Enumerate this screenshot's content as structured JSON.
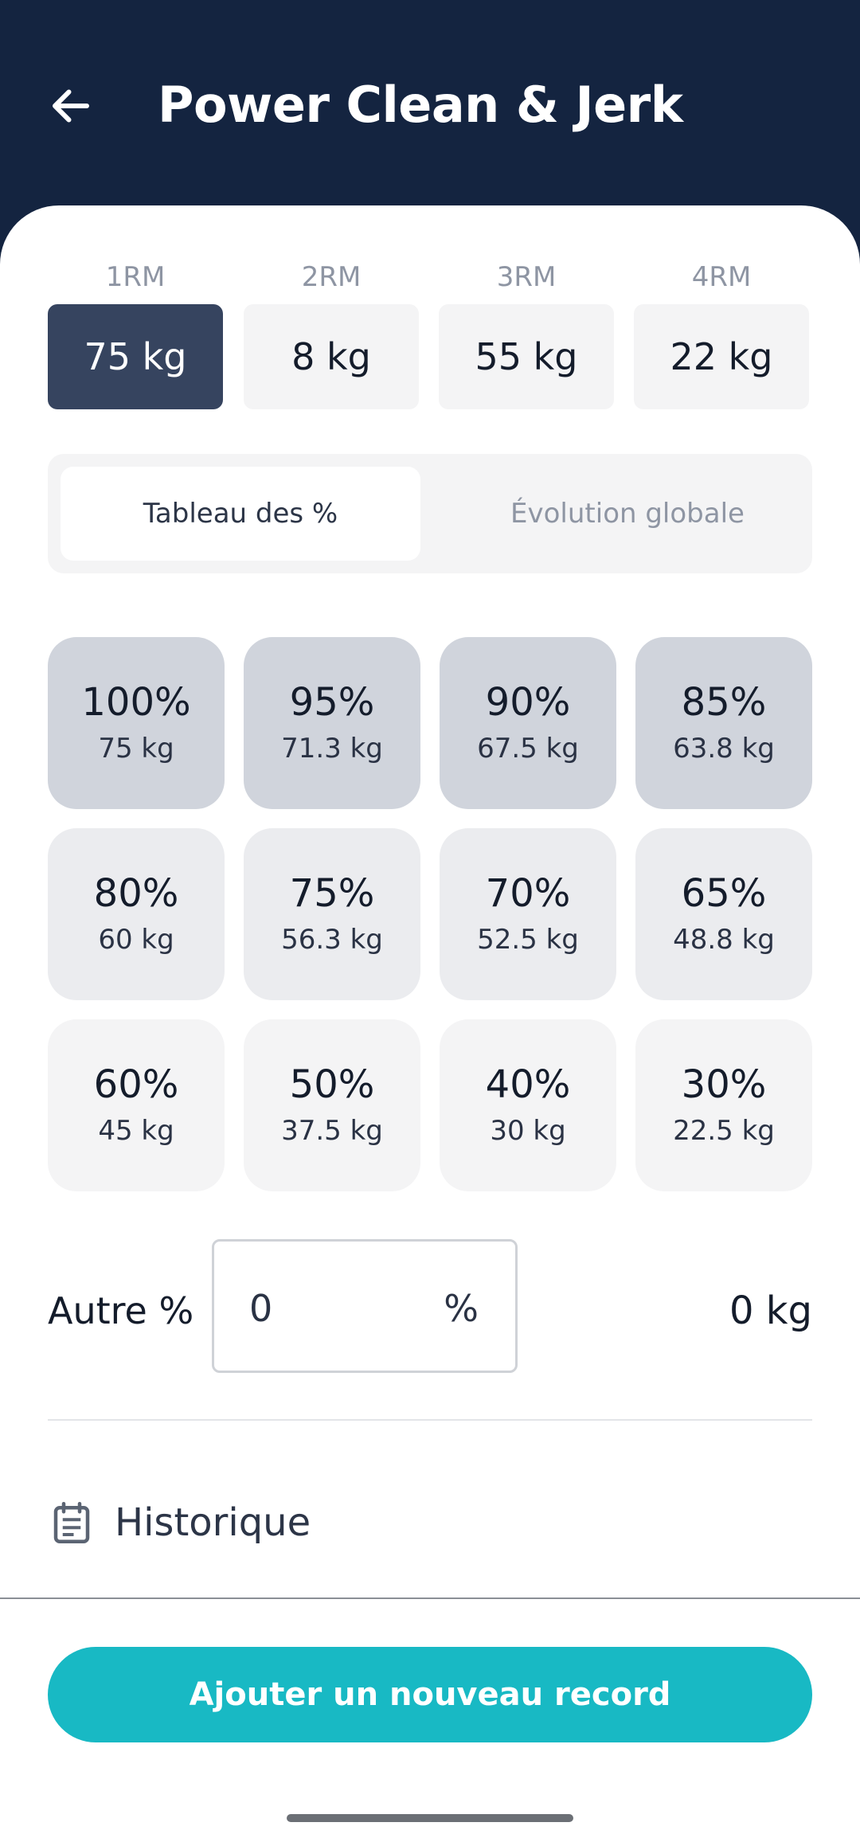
{
  "header": {
    "title": "Power Clean & Jerk",
    "back_icon": "arrow-left-icon"
  },
  "rm": [
    {
      "label": "1RM",
      "value": "75 kg",
      "selected": true
    },
    {
      "label": "2RM",
      "value": "8 kg",
      "selected": false
    },
    {
      "label": "3RM",
      "value": "55 kg",
      "selected": false
    },
    {
      "label": "4RM",
      "value": "22 kg",
      "selected": false
    }
  ],
  "tabs": {
    "table": "Tableau des %",
    "evolution": "Évolution globale",
    "active": "table"
  },
  "percentages": [
    {
      "pct": "100%",
      "kg": "75 kg"
    },
    {
      "pct": "95%",
      "kg": "71.3 kg"
    },
    {
      "pct": "90%",
      "kg": "67.5 kg"
    },
    {
      "pct": "85%",
      "kg": "63.8 kg"
    },
    {
      "pct": "80%",
      "kg": "60 kg"
    },
    {
      "pct": "75%",
      "kg": "56.3 kg"
    },
    {
      "pct": "70%",
      "kg": "52.5 kg"
    },
    {
      "pct": "65%",
      "kg": "48.8 kg"
    },
    {
      "pct": "60%",
      "kg": "45 kg"
    },
    {
      "pct": "50%",
      "kg": "37.5 kg"
    },
    {
      "pct": "40%",
      "kg": "30 kg"
    },
    {
      "pct": "30%",
      "kg": "22.5 kg"
    }
  ],
  "other": {
    "label": "Autre %",
    "value": "0",
    "unit": "%",
    "result": "0 kg"
  },
  "history": {
    "label": "Historique",
    "icon": "calendar-icon"
  },
  "cta": {
    "label": "Ajouter un nouveau record"
  },
  "colors": {
    "header_bg": "#142440",
    "selected_rm": "#36445f",
    "accent": "#18b9c4"
  }
}
